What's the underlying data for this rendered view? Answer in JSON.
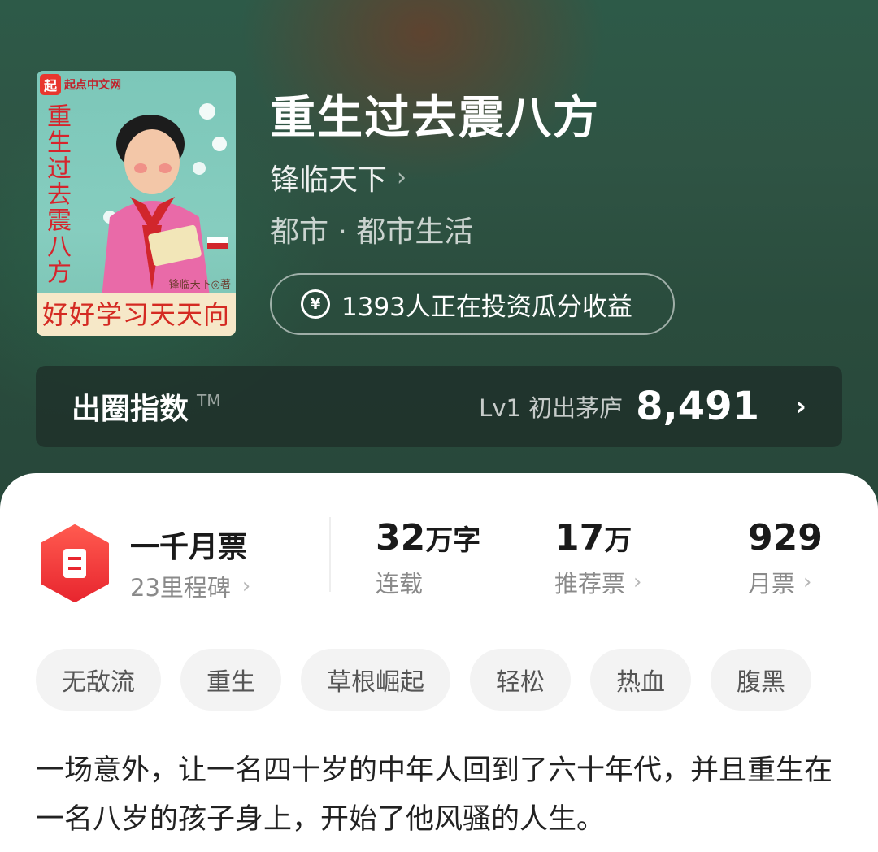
{
  "book": {
    "title": "重生过去震八方",
    "author": "锋临天下",
    "genre": "都市 · 都市生活",
    "investors_text": "1393人正在投资瓜分收益",
    "cover": {
      "brand": "起点中文网",
      "brand_logo": "起",
      "vertical_title": "重生过去震八方",
      "slogan": "好好学习天天向上",
      "stamp": "锋临天下◎著"
    }
  },
  "index_bar": {
    "label": "出圈指数",
    "tm": "TM",
    "level": "Lv1 初出茅庐",
    "score": "8,491"
  },
  "stats": {
    "milestone_title": "一千月票",
    "milestone_sub": "23里程碑",
    "words_num": "32",
    "words_unit": "万字",
    "words_cap": "连载",
    "recommend_num": "17",
    "recommend_unit": "万",
    "recommend_cap": "推荐票",
    "monthly_num": "929",
    "monthly_cap": "月票"
  },
  "tags": [
    "无敌流",
    "重生",
    "草根崛起",
    "轻松",
    "热血",
    "腹黑"
  ],
  "description": "一场意外，让一名四十岁的中年人回到了六十年代，并且重生在一名八岁的孩子身上，开始了他风骚的人生。",
  "colors": {
    "accent_red": "#ee3b3b",
    "hero_green": "#2d5a48"
  }
}
